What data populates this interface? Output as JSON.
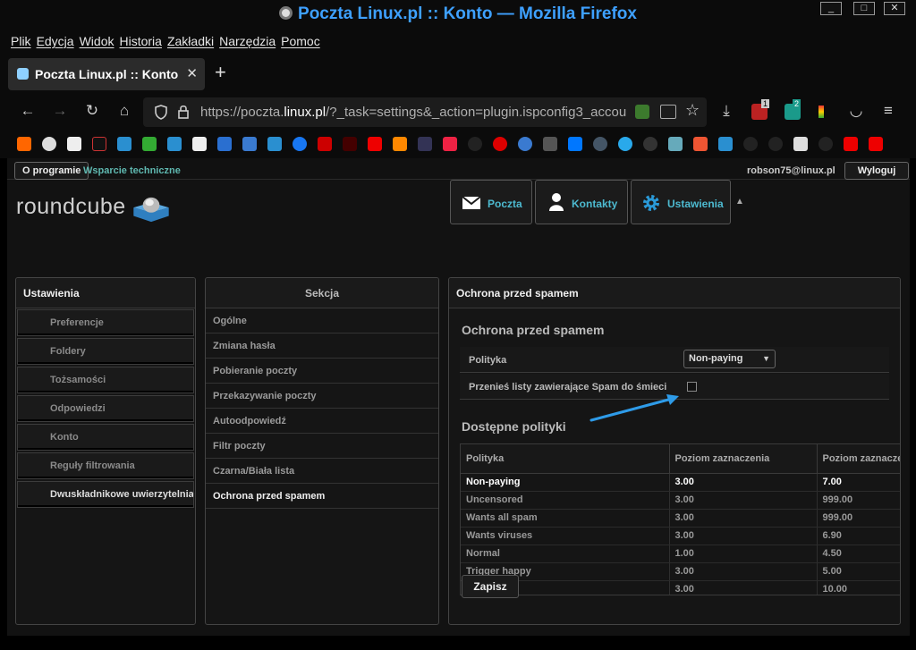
{
  "window": {
    "title": "Poczta Linux.pl :: Konto — Mozilla Firefox",
    "btn_min": "_",
    "btn_max": "□",
    "btn_close": "✕"
  },
  "menubar": [
    "Plik",
    "Edycja",
    "Widok",
    "Historia",
    "Zakładki",
    "Narzędzia",
    "Pomoc"
  ],
  "tab": {
    "label": "Poczta Linux.pl :: Konto",
    "close": "✕",
    "new": "+"
  },
  "nav": {
    "url_prefix": "https://poczta.",
    "url_domain": "linux.pl",
    "url_rest": "/?_task=settings&_action=plugin.ispconfig3_accou",
    "badge_1": "1",
    "badge_2": "2"
  },
  "colors": {
    "accent": "#3ea0ff",
    "teal": "#4dbad0",
    "arrow": "#2e9be8"
  },
  "topbar": {
    "about": "O programie",
    "support": "Wsparcie techniczne",
    "user": "robson75@linux.pl",
    "logout": "Wyloguj"
  },
  "logo": {
    "text": "roundcube"
  },
  "mainnav": {
    "mail": "Poczta",
    "contacts": "Kontakty",
    "settings": "Ustawienia"
  },
  "settings_panel": {
    "title": "Ustawienia",
    "items": [
      "Preferencje",
      "Foldery",
      "Tożsamości",
      "Odpowiedzi",
      "Konto",
      "Reguły filtrowania",
      "Dwuskładnikowe uwierzytelniani"
    ]
  },
  "section_panel": {
    "title": "Sekcja",
    "items": [
      "Ogólne",
      "Zmiana hasła",
      "Pobieranie poczty",
      "Przekazywanie poczty",
      "Autoodpowiedź",
      "Filtr poczty",
      "Czarna/Biała lista",
      "Ochrona przed spamem"
    ]
  },
  "content": {
    "header": "Ochrona przed spamem",
    "section_title": "Ochrona przed spamem",
    "policy_label": "Polityka",
    "policy_value": "Non-paying",
    "move_label": "Przenieś listy zawierające Spam do śmieci",
    "available_title": "Dostępne polityki",
    "table": {
      "headers": [
        "Polityka",
        "Poziom zaznaczenia",
        "Poziom zaznacze"
      ],
      "rows": [
        [
          "Non-paying",
          "3.00",
          "7.00"
        ],
        [
          "Uncensored",
          "3.00",
          "999.00"
        ],
        [
          "Wants all spam",
          "3.00",
          "999.00"
        ],
        [
          "Wants viruses",
          "3.00",
          "6.90"
        ],
        [
          "Normal",
          "1.00",
          "4.50"
        ],
        [
          "Trigger happy",
          "3.00",
          "5.00"
        ],
        [
          "",
          "3.00",
          "10.00"
        ]
      ]
    },
    "save": "Zapisz"
  }
}
